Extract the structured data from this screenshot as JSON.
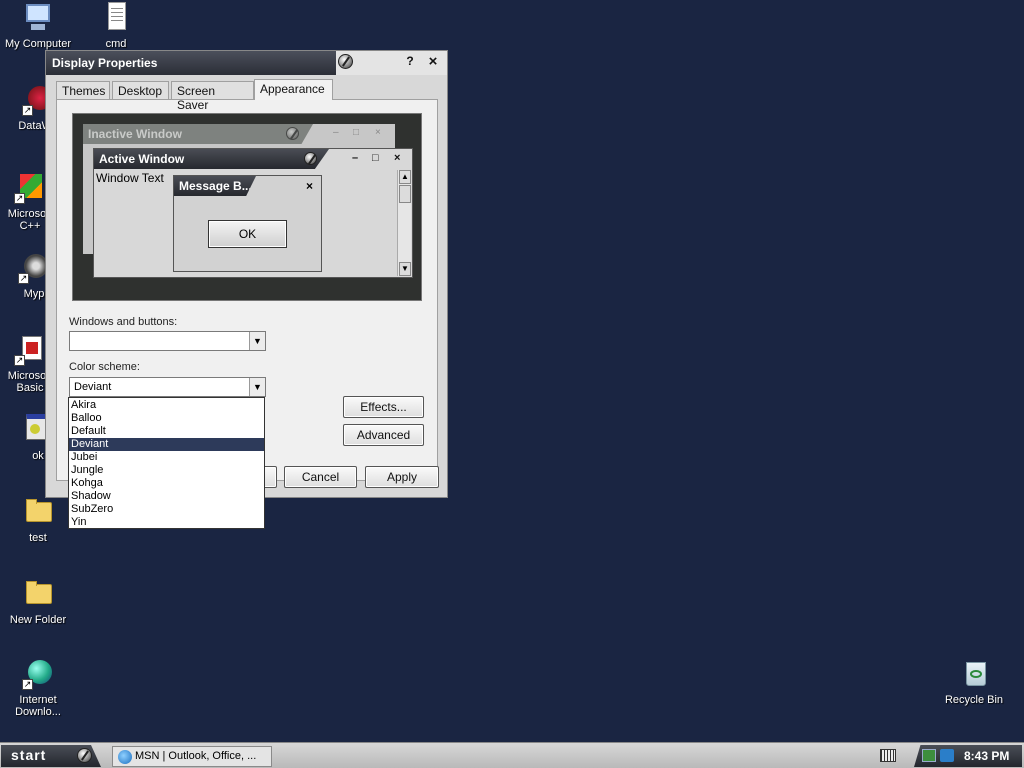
{
  "desktop": {
    "icons": [
      {
        "label": "My Computer"
      },
      {
        "label": "cmd"
      },
      {
        "label": "DataWa"
      },
      {
        "label": "Microsoft\nC++"
      },
      {
        "label": "Myp"
      },
      {
        "label": "Microsoft\nBasic"
      },
      {
        "label": "ok"
      },
      {
        "label": "test"
      },
      {
        "label": "New Folder"
      },
      {
        "label": "Internet\nDownlo..."
      },
      {
        "label": "Recycle Bin"
      }
    ]
  },
  "window": {
    "title": "Display Properties",
    "help_label": "?",
    "close_label": "×",
    "tabs": [
      {
        "label": "Themes"
      },
      {
        "label": "Desktop"
      },
      {
        "label": "Screen Saver"
      },
      {
        "label": "Appearance"
      }
    ],
    "preview": {
      "inactive_title": "Inactive Window",
      "active_title": "Active Window",
      "window_text": "Window Text",
      "message_title": "Message B...",
      "message_close": "×",
      "ok_label": "OK"
    },
    "windows_buttons_label": "Windows and buttons:",
    "windows_buttons_value": "",
    "color_scheme_label": "Color scheme:",
    "color_scheme_value": "Deviant",
    "color_scheme_options": [
      "Akira",
      "Balloo",
      "Default",
      "Deviant",
      "Jubei",
      "Jungle",
      "Kohga",
      "Shadow",
      "SubZero",
      "Yin"
    ],
    "effects_label": "Effects...",
    "advanced_label": "Advanced",
    "cancel_label": "Cancel",
    "apply_label": "Apply"
  },
  "taskbar": {
    "start_label": "start",
    "task_label": "MSN | Outlook, Office, ...",
    "clock": "8:43 PM"
  },
  "colors": {
    "desktop": "#1a2542",
    "selection": "#2d3a5a",
    "titlebar": "#2b2e37"
  }
}
